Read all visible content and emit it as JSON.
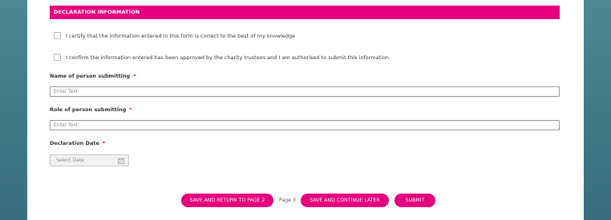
{
  "section": {
    "title": "DECLARATION INFORMATION"
  },
  "checkboxes": [
    {
      "label": "I certify that the information entered in this form is correct to the best of my knowledge",
      "checked": false
    },
    {
      "label": "I confirm the information entered has been approved by the charity trustees and I am authorised to submit this information",
      "checked": false
    }
  ],
  "fields": {
    "name": {
      "label": "Name of person submitting",
      "required_mark": "*",
      "placeholder": "Enter Text",
      "value": ""
    },
    "role": {
      "label": "Role of person submitting",
      "required_mark": "*",
      "placeholder": "Enter Text",
      "value": ""
    },
    "date": {
      "label": "Declaration Date",
      "required_mark": "*",
      "placeholder": "Select Date",
      "icon": "calendar-icon"
    }
  },
  "footer": {
    "save_return_label": "SAVE AND RETURN TO PAGE 2",
    "page_label": "Page 3",
    "save_continue_label": "SAVE AND CONTINUE LATER",
    "submit_label": "SUBMIT"
  },
  "colors": {
    "accent": "#e6007e",
    "background": "#3e7b86",
    "panel": "#ffffff"
  }
}
